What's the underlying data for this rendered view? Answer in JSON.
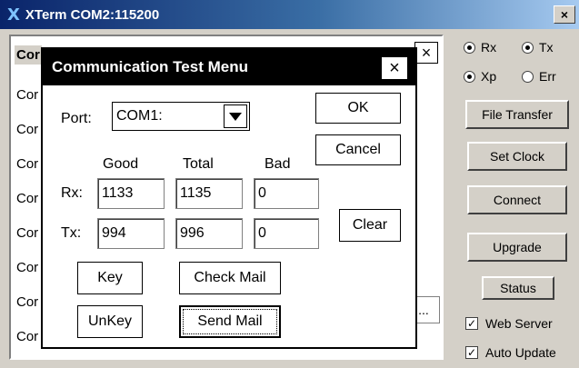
{
  "window": {
    "title": "XTerm COM2:115200",
    "close_glyph": "×"
  },
  "list": {
    "header": "Cor",
    "rows": [
      "Cor",
      "Cor",
      "Cor",
      "Cor",
      "Cor",
      "Cor",
      "Cor",
      "Cor"
    ],
    "close_glyph": "×",
    "ellipsis": "..."
  },
  "right_panel": {
    "radios": [
      {
        "label": "Rx",
        "checked": true
      },
      {
        "label": "Tx",
        "checked": true
      },
      {
        "label": "Xp",
        "checked": true
      },
      {
        "label": "Err",
        "checked": false
      }
    ],
    "buttons": [
      "File Transfer",
      "Set Clock",
      "Connect",
      "Upgrade",
      "Status"
    ],
    "checks": [
      {
        "label": "Web Server",
        "checked": true
      },
      {
        "label": "Auto Update",
        "checked": true
      }
    ]
  },
  "dialog": {
    "title": "Communication Test Menu",
    "close_glyph": "×",
    "port_label": "Port:",
    "port_value": "COM1:",
    "ok": "OK",
    "cancel": "Cancel",
    "clear": "Clear",
    "headers": {
      "good": "Good",
      "total": "Total",
      "bad": "Bad"
    },
    "rx": {
      "label": "Rx:",
      "good": "1133",
      "total": "1135",
      "bad": "0"
    },
    "tx": {
      "label": "Tx:",
      "good": "994",
      "total": "996",
      "bad": "0"
    },
    "key": "Key",
    "unkey": "UnKey",
    "check_mail": "Check Mail",
    "send_mail": "Send Mail"
  }
}
